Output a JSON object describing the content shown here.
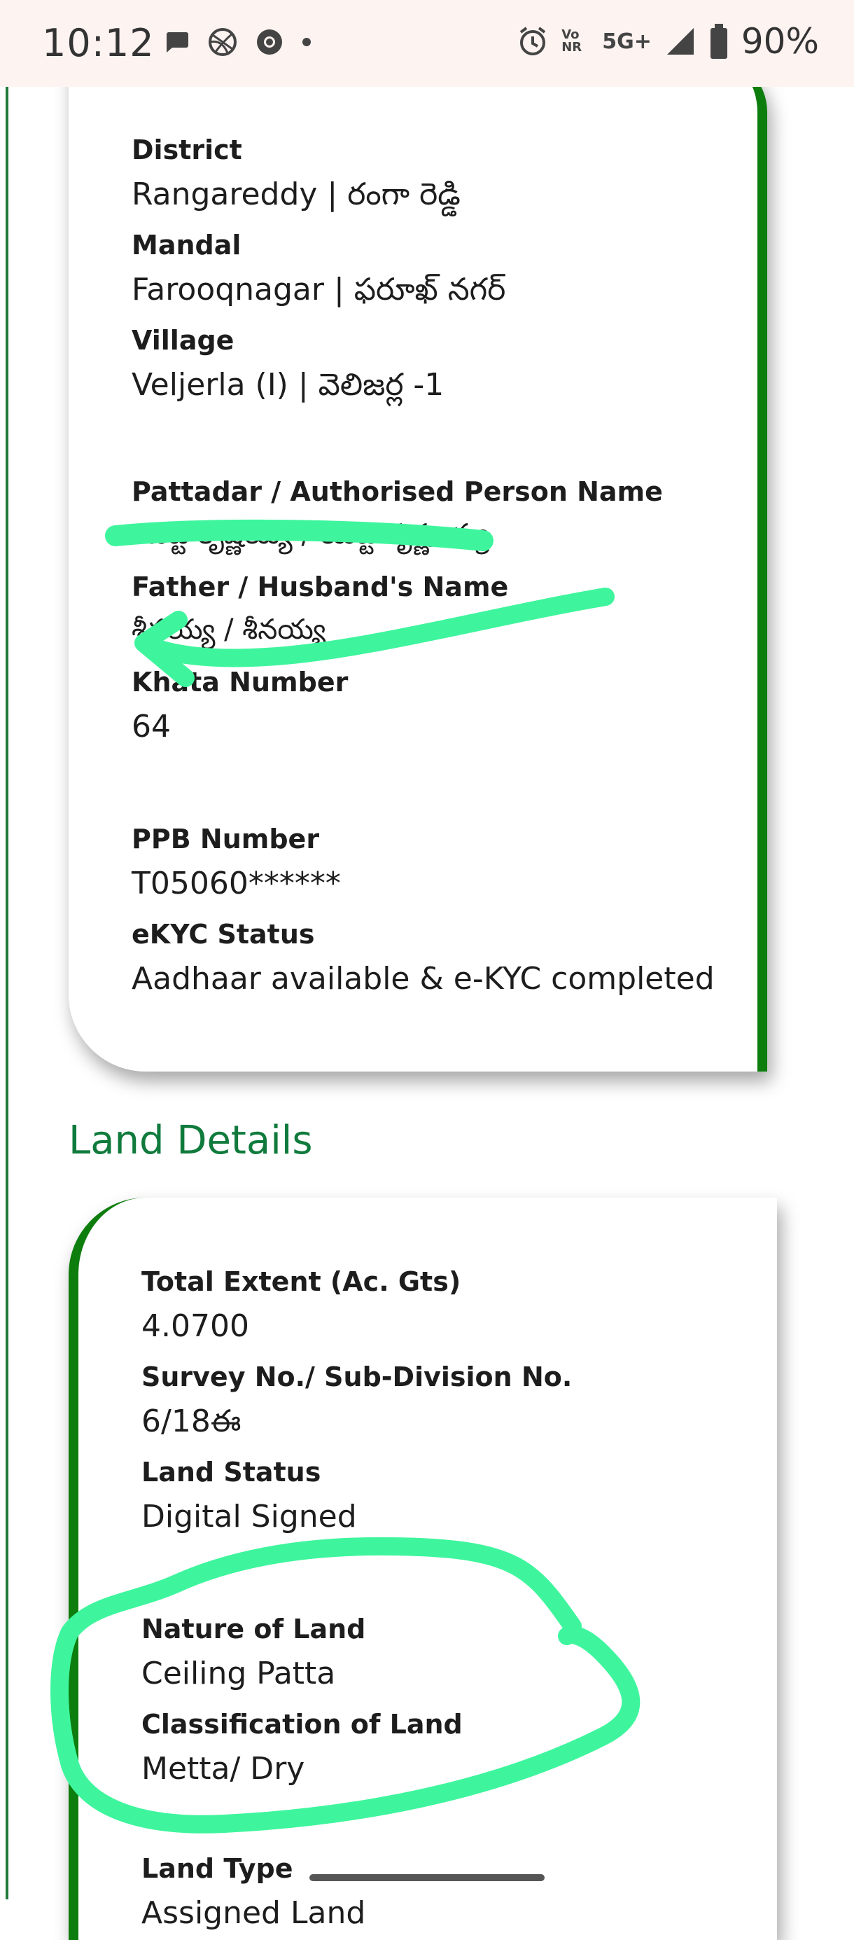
{
  "status_bar": {
    "time": "10:12",
    "network": "5G+",
    "volte": "Vo NR",
    "battery": "90%",
    "icons": [
      "message-icon",
      "basketball-icon",
      "chrome-icon",
      "dot-icon",
      "alarm-icon",
      "signal-icon",
      "battery-icon"
    ]
  },
  "owner_card": {
    "district_label": "District",
    "district_value": "Rangareddy | రంగా రెడ్డి",
    "mandal_label": "Mandal",
    "mandal_value": "Farooqnagar | ఫరూఖ్ నగర్",
    "village_label": "Village",
    "village_value": "Veljerla (I) | వెలిజర్ల -1",
    "pattadar_label": "Pattadar / Authorised Person Name",
    "pattadar_value": "యట్ట కృష్ణయ్య / యట్ట కృష్ణ య్య",
    "father_label": "Father / Husband's Name",
    "father_value": "శీనయ్య / శీనయ్య",
    "khata_label": "Khata Number",
    "khata_value": "64",
    "ppb_label": "PPB Number",
    "ppb_value": "T05060******",
    "ekyc_label": "eKYC Status",
    "ekyc_value": "Aadhaar available & e-KYC completed"
  },
  "land_section_title": "Land Details",
  "land_card": {
    "extent_label": "Total Extent (Ac. Gts)",
    "extent_value": "4.0700",
    "survey_label": "Survey No./ Sub-Division No.",
    "survey_value": "6/18ఈ",
    "status_label": "Land Status",
    "status_value": "Digital Signed",
    "nature_label": "Nature of Land",
    "nature_value": "Ceiling Patta",
    "class_label": "Classification of Land",
    "class_value": "Metta/ Dry",
    "type_label": "Land Type",
    "type_value": "Assigned Land"
  },
  "colors": {
    "accent_green": "#0d7d0d",
    "title_green": "#0f7a3c",
    "annotation_green": "#3ef59d"
  }
}
